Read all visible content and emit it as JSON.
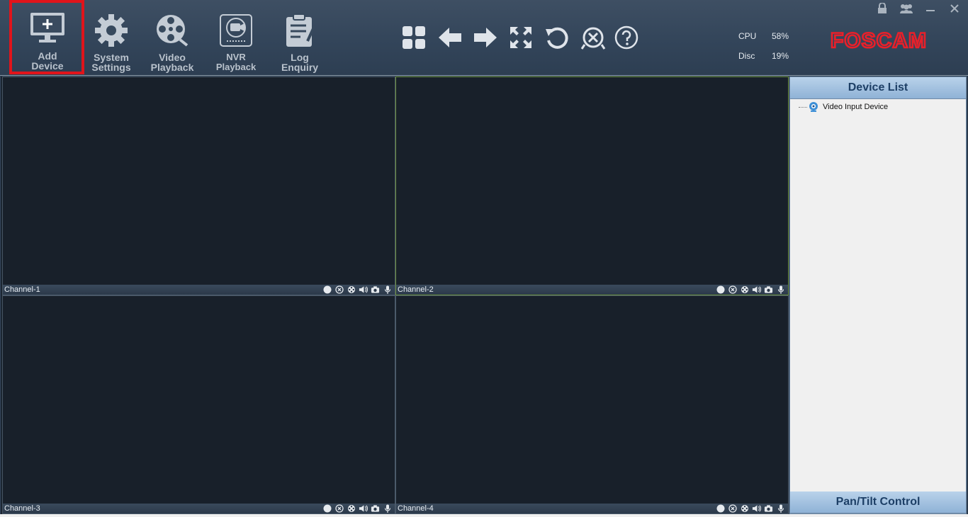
{
  "toolbar": {
    "add_device": {
      "line1": "Add",
      "line2": "Device"
    },
    "system_settings": {
      "line1": "System",
      "line2": "Settings"
    },
    "video_playback": {
      "line1": "Video",
      "line2": "Playback"
    },
    "nvr_playback": {
      "line1": "NVR",
      "line2": "Playback"
    },
    "log_enquiry": {
      "line1": "Log",
      "line2": "Enquiry"
    }
  },
  "nav_icons": [
    "layout-grid-icon",
    "arrow-left-icon",
    "arrow-right-icon",
    "fullscreen-icon",
    "refresh-icon",
    "close-circle-icon",
    "help-icon"
  ],
  "window_controls": [
    "lock-icon",
    "users-icon",
    "minimize-icon",
    "close-icon"
  ],
  "stats": {
    "cpu_label": "CPU",
    "cpu_value": "58%",
    "disc_label": "Disc",
    "disc_value": "19%"
  },
  "brand": {
    "name": "FOSCAM",
    "color": "#e8202a"
  },
  "channels": [
    {
      "name": "Channel-1"
    },
    {
      "name": "Channel-2"
    },
    {
      "name": "Channel-3"
    },
    {
      "name": "Channel-4"
    }
  ],
  "channel_controls": [
    "record-dot-icon",
    "close-stream-icon",
    "ptz-icon",
    "speaker-icon",
    "camera-snapshot-icon",
    "microphone-icon"
  ],
  "panel": {
    "device_list_title": "Device List",
    "tree_item": "Video Input Device",
    "ptz_title": "Pan/Tilt Control"
  },
  "colors": {
    "highlight": "#e0141b",
    "accent": "#1d3f66"
  }
}
